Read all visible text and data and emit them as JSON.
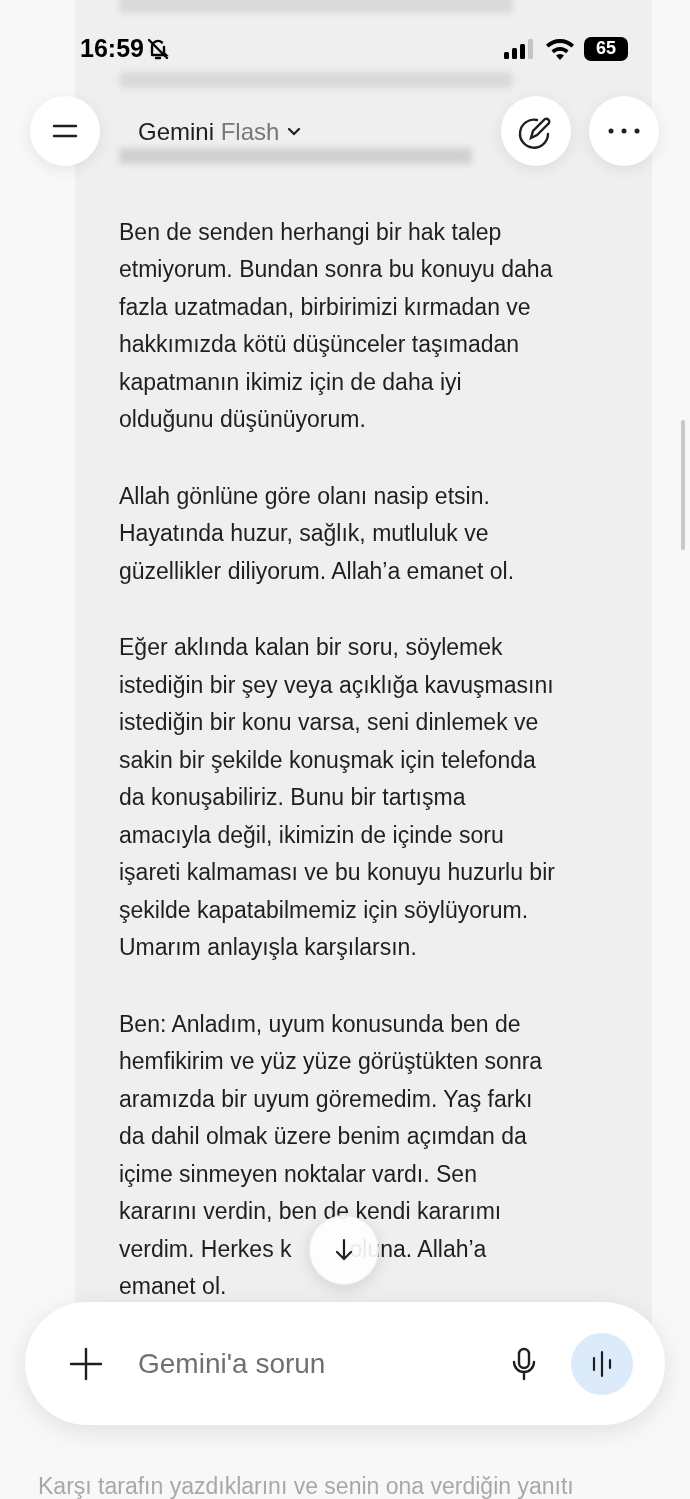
{
  "status_bar": {
    "time": "16:59",
    "battery": "65"
  },
  "header": {
    "model_name": "Gemini",
    "model_variant": "Flash"
  },
  "paragraphs": [
    {
      "lines": [
        "Ben de senden herhangi bir hak talep",
        "etmiyorum. Bundan sonra bu konuyu daha",
        "fazla uzatmadan, birbirimizi kırmadan ve",
        "hakkımızda kötü düşünceler taşımadan",
        "kapatmanın ikimiz için de daha iyi",
        "olduğunu düşünüyorum."
      ]
    },
    {
      "lines": [
        "Allah gönlüne göre olanı nasip etsin.",
        "Hayatında huzur, sağlık, mutluluk ve",
        "güzellikler diliyorum. Allah’a emanet ol."
      ]
    },
    {
      "lines": [
        "Eğer aklında kalan bir soru, söylemek",
        "istediğin bir şey veya açıklığa kavuşmasını",
        "istediğin bir konu varsa, seni dinlemek ve",
        "sakin bir şekilde konuşmak için telefonda",
        "da konuşabiliriz. Bunu bir tartışma",
        "amacıyla değil, ikimizin de içinde soru",
        "işareti kalmaması ve bu konuyu huzurlu bir",
        "şekilde kapatabilmemiz için söylüyorum.",
        "Umarım anlayışla karşılarsın."
      ]
    },
    {
      "lines": [
        "Ben: Anladım, uyum konusunda ben de",
        "hemfikirim ve yüz yüze görüştükten sonra",
        "aramızda bir uyum göremedim. Yaş farkı",
        "da dahil olmak üzere benim açımdan da",
        "içime sinmeyen noktalar vardı. Sen",
        "kararını verdin, ben de kendi kararımı",
        [
          "verdim. Herkes k",
          "oluna. Allah’a"
        ],
        "emanet ol."
      ]
    }
  ],
  "composer": {
    "placeholder": "Gemini'a sorun"
  },
  "footer_text": "Karşı tarafın yazdıklarını ve senin ona verdiğin yanıtı"
}
